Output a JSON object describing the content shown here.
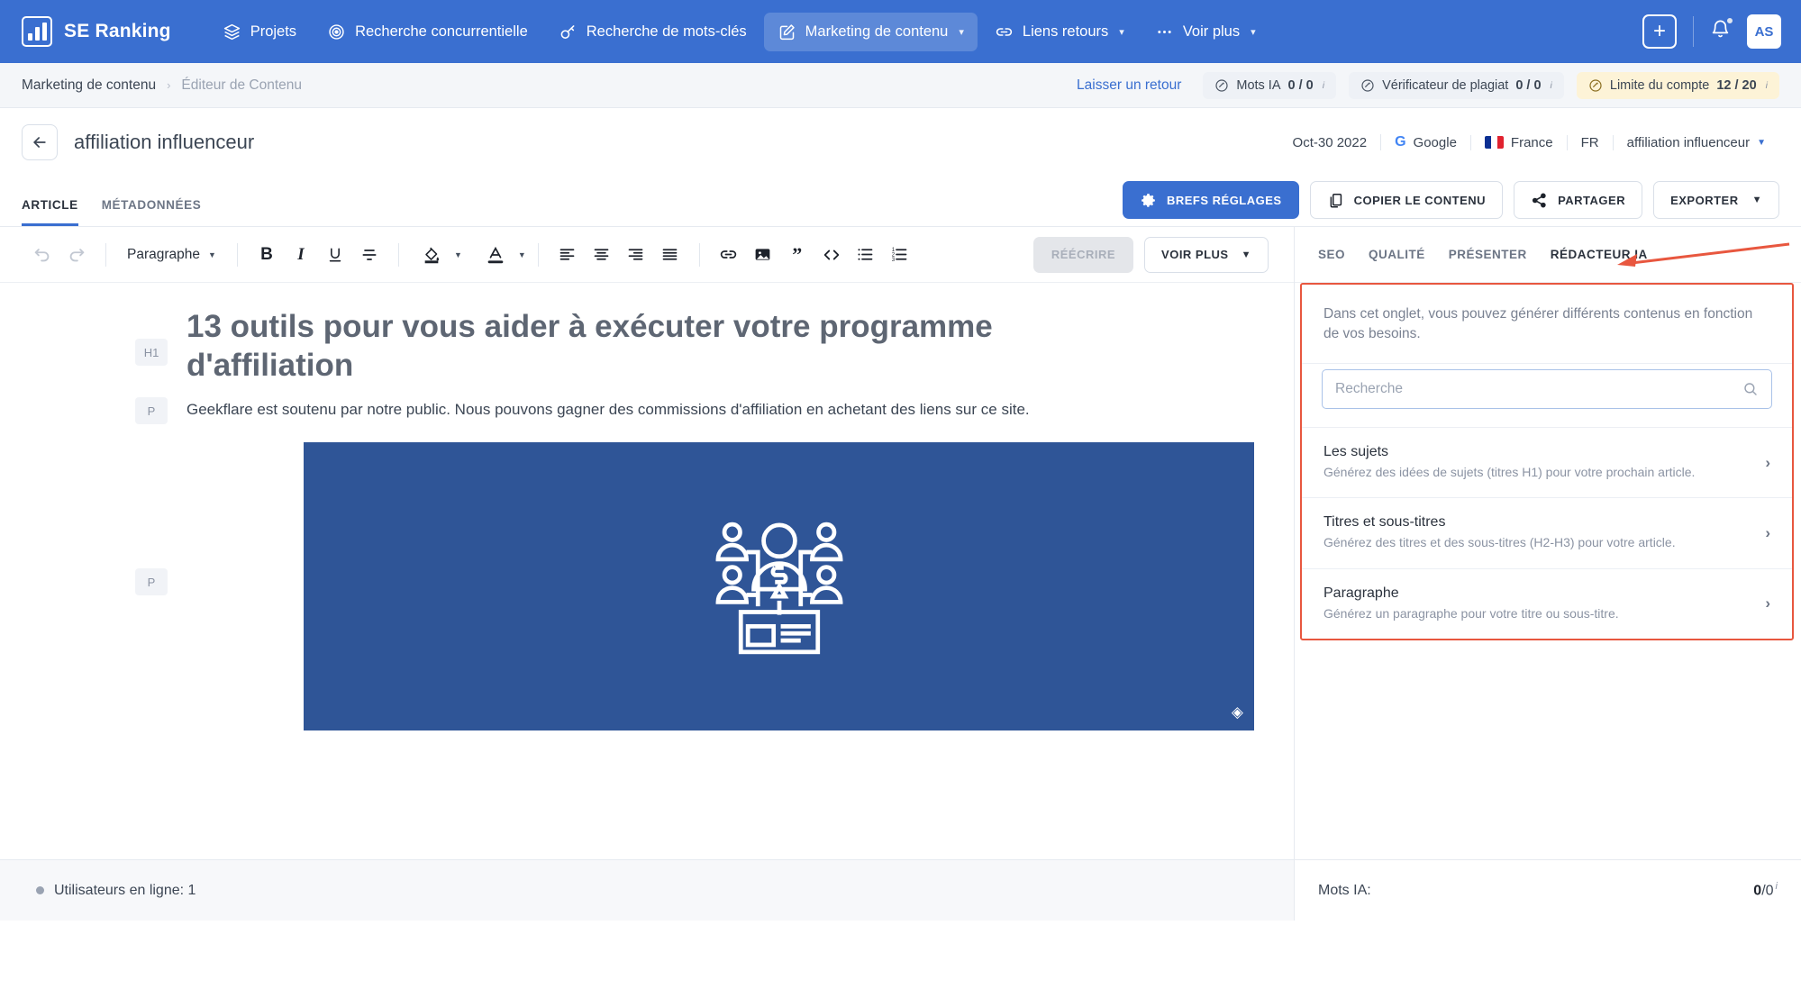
{
  "topnav": {
    "brand": "SE Ranking",
    "items": [
      {
        "label": "Projets",
        "icon": "layers-icon",
        "active": false,
        "caret": false
      },
      {
        "label": "Recherche concurrentielle",
        "icon": "target-icon",
        "active": false,
        "caret": false
      },
      {
        "label": "Recherche de mots-clés",
        "icon": "key-icon",
        "active": false,
        "caret": false
      },
      {
        "label": "Marketing de contenu",
        "icon": "edit-square-icon",
        "active": true,
        "caret": true
      },
      {
        "label": "Liens retours",
        "icon": "link-icon",
        "active": false,
        "caret": true
      },
      {
        "label": "Voir plus",
        "icon": "ellipsis-icon",
        "active": false,
        "caret": true
      }
    ],
    "add_label": "+",
    "avatar_initials": "AS",
    "accent": "#3a6fd0"
  },
  "breadcrumb": {
    "parent": "Marketing de contenu",
    "separator": "›",
    "current": "Éditeur de Contenu",
    "feedback": "Laisser un retour",
    "pills": [
      {
        "label": "Mots IA",
        "value": "0 / 0",
        "icon": "ai-badge-icon",
        "warn": false,
        "info": "i"
      },
      {
        "label": "Vérificateur de plagiat",
        "value": "0 / 0",
        "icon": "ai-badge-icon",
        "warn": false,
        "info": "i"
      },
      {
        "label": "Limite du compte",
        "value": "12 / 20",
        "icon": "ai-badge-icon",
        "warn": true,
        "info": "i"
      }
    ]
  },
  "doc": {
    "title": "affiliation influenceur",
    "date": "Oct-30 2022",
    "engine": "Google",
    "country": "France",
    "lang": "FR",
    "keyword": "affiliation influenceur"
  },
  "doctabs": [
    {
      "label": "ARTICLE",
      "active": true
    },
    {
      "label": "MÉTADONNÉES",
      "active": false
    }
  ],
  "actions": [
    {
      "label": "BREFS RÉGLAGES",
      "icon": "gear-icon",
      "primary": true
    },
    {
      "label": "COPIER LE CONTENU",
      "icon": "copy-icon",
      "primary": false
    },
    {
      "label": "PARTAGER",
      "icon": "share-icon",
      "primary": false
    },
    {
      "label": "EXPORTER",
      "icon": "chevron-down-icon",
      "primary": false,
      "caret": true
    }
  ],
  "editor_toolbar": {
    "undo": "undo-icon",
    "redo": "redo-icon",
    "block_format": "Paragraphe",
    "bold": "B",
    "italic": "I",
    "underline": "U",
    "strikethrough": "S",
    "rewrite_label": "RÉÉCRIRE",
    "more_label": "VOIR PLUS"
  },
  "document": {
    "h1_tag": "H1",
    "h1": "13 outils pour vous aider à exécuter votre programme d'affiliation",
    "p_tag": "P",
    "paragraph": "Geekflare est soutenu par notre public. Nous pouvons gagner des commissions d'affiliation en achetant des liens sur ce site.",
    "image_tag": "P",
    "image_bg": "#2f5597",
    "image_alt": "affiliate-marketing-illustration"
  },
  "side_panel": {
    "tabs": [
      {
        "label": "SEO",
        "active": false
      },
      {
        "label": "QUALITÉ",
        "active": false
      },
      {
        "label": "PRÉSENTER",
        "active": false
      },
      {
        "label": "RÉDACTEUR IA",
        "active": true
      }
    ],
    "intro": "Dans cet onglet, vous pouvez générer différents contenus en fonction de vos besoins.",
    "search_placeholder": "Recherche",
    "search_value": "",
    "items": [
      {
        "title": "Les sujets",
        "desc": "Générez des idées de sujets (titres H1) pour votre prochain article."
      },
      {
        "title": "Titres et sous-titres",
        "desc": "Générez des titres et des sous-titres (H2-H3) pour votre article."
      },
      {
        "title": "Paragraphe",
        "desc": "Générez un paragraphe pour votre titre ou sous-titre."
      }
    ],
    "highlight_color": "#e8573f"
  },
  "statusbar": {
    "online_label": "Utilisateurs en ligne: 1",
    "ai_words_label": "Mots IA:",
    "ai_words_current": "0",
    "ai_words_total": "/0",
    "ai_words_info": "i"
  }
}
